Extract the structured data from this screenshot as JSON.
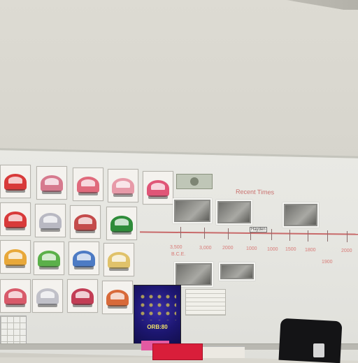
{
  "scene": {
    "board_heading": "Recent Times",
    "box_label": "Hayden",
    "timeline_labels": [
      "3,500",
      "B.C.E.",
      "3,000",
      "2000",
      "1000",
      "1000",
      "1500",
      "1800",
      "1900",
      "2000"
    ],
    "poster_title": "ORB:80"
  },
  "colors": {
    "wall": "#d8d6ce",
    "whiteboard": "#e7e7e2",
    "marker_red": "#d87a76",
    "poster_blue": "#1c1670"
  },
  "bug_cards": [
    {
      "color": "#d83a3a"
    },
    {
      "color": "#d67a8e"
    },
    {
      "color": "#e06a7c"
    },
    {
      "color": "#e79aa8"
    },
    {
      "color": "#e05577"
    },
    {
      "color": "#d83a3a"
    },
    {
      "color": "#b8b8c2"
    },
    {
      "color": "#c44b4b"
    },
    {
      "color": "#2f8c3a"
    },
    {
      "color": "#e8a83a"
    },
    {
      "color": "#5bb04a"
    },
    {
      "color": "#4d7bc4"
    },
    {
      "color": "#e0c26a"
    },
    {
      "color": "#d85a6a"
    },
    {
      "color": "#c0c0c8"
    },
    {
      "color": "#c23d55"
    },
    {
      "color": "#d86a3a"
    }
  ]
}
